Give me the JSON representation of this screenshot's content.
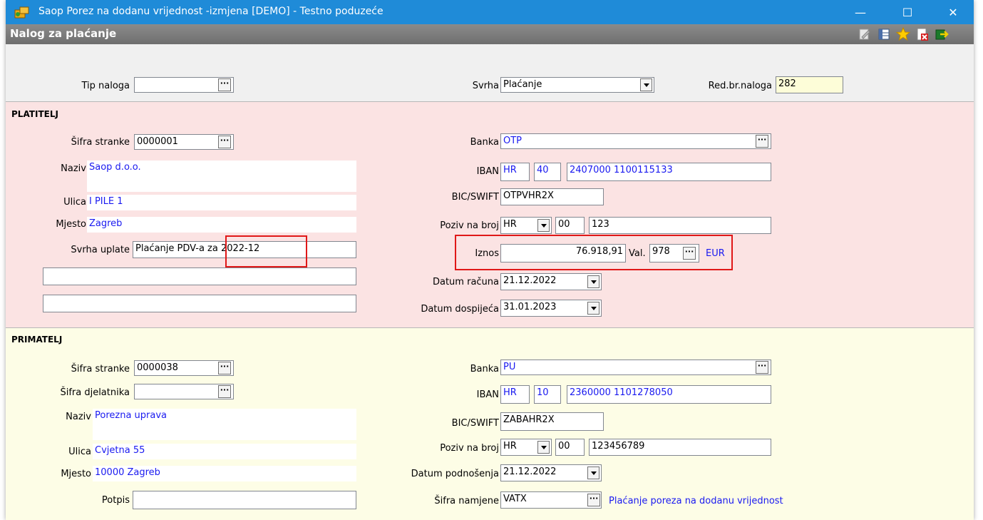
{
  "window": {
    "title": "Saop Porez na dodanu vrijednost -izmjena  [DEMO] - Testno poduzeće",
    "minimize": "—",
    "maximize": "☐",
    "close": "✕"
  },
  "toolbar": {
    "title": "Nalog za plaćanje"
  },
  "header": {
    "tip_naloga_label": "Tip naloga",
    "tip_naloga_value": "",
    "svrha_label": "Svrha",
    "svrha_value": "Plaćanje",
    "red_br_label": "Red.br.naloga",
    "red_br_value": "282"
  },
  "platitelj": {
    "heading": "PLATITELJ",
    "sifra_stranke_label": "Šifra stranke",
    "sifra_stranke_value": "0000001",
    "naziv_label": "Naziv",
    "naziv_value": "Saop d.o.o.",
    "ulica_label": "Ulica",
    "ulica_value": "I PILE 1",
    "mjesto_label": "Mjesto",
    "mjesto_value": "Zagreb",
    "svrha_uplate_label": "Svrha uplate",
    "svrha_uplate_value": "Plaćanje PDV-a za 2022-12",
    "extra1": "",
    "extra2": "",
    "banka_label": "Banka",
    "banka_value": "OTP",
    "iban_label": "IBAN",
    "iban_country": "HR",
    "iban_check": "40",
    "iban_number": "2407000 1100115133",
    "bic_label": "BIC/SWIFT",
    "bic_value": "OTPVHR2X",
    "poziv_label": "Poziv na broj",
    "poziv_country": "HR",
    "poziv_model": "00",
    "poziv_number": "123",
    "iznos_label": "Iznos",
    "iznos_value": "76.918,91",
    "val_label": "Val.",
    "val_code": "978",
    "val_name": "EUR",
    "datum_racuna_label": "Datum računa",
    "datum_racuna_value": "21.12.2022",
    "datum_dospijeca_label": "Datum dospijeća",
    "datum_dospijeca_value": "31.01.2023"
  },
  "primatelj": {
    "heading": "PRIMATELJ",
    "sifra_stranke_label": "Šifra stranke",
    "sifra_stranke_value": "0000038",
    "sifra_djelatnika_label": "Šifra djelatnika",
    "sifra_djelatnika_value": "",
    "naziv_label": "Naziv",
    "naziv_value": "Porezna uprava",
    "ulica_label": "Ulica",
    "ulica_value": "Cvjetna 55",
    "mjesto_label": "Mjesto",
    "mjesto_value": "10000 Zagreb",
    "potpis_label": "Potpis",
    "potpis_value": "",
    "banka_label": "Banka",
    "banka_value": "PU",
    "iban_label": "IBAN",
    "iban_country": "HR",
    "iban_check": "10",
    "iban_number": "2360000 1101278050",
    "bic_label": "BIC/SWIFT",
    "bic_value": "ZABAHR2X",
    "poziv_label": "Poziv na broj",
    "poziv_country": "HR",
    "poziv_model": "00",
    "poziv_number": "123456789",
    "datum_podnosenja_label": "Datum podnošenja",
    "datum_podnosenja_value": "21.12.2022",
    "sifra_namjene_label": "Šifra namjene",
    "sifra_namjene_value": "VATX",
    "sifra_namjene_desc": "Plaćanje poreza na dodanu vrijednost"
  },
  "colors": {
    "titlebar": "#1f8bd8",
    "platitelj_bg": "#fbe3e3",
    "primatelj_bg": "#fdfde6",
    "highlight": "#e01818",
    "value_blue": "#1a1af0"
  }
}
